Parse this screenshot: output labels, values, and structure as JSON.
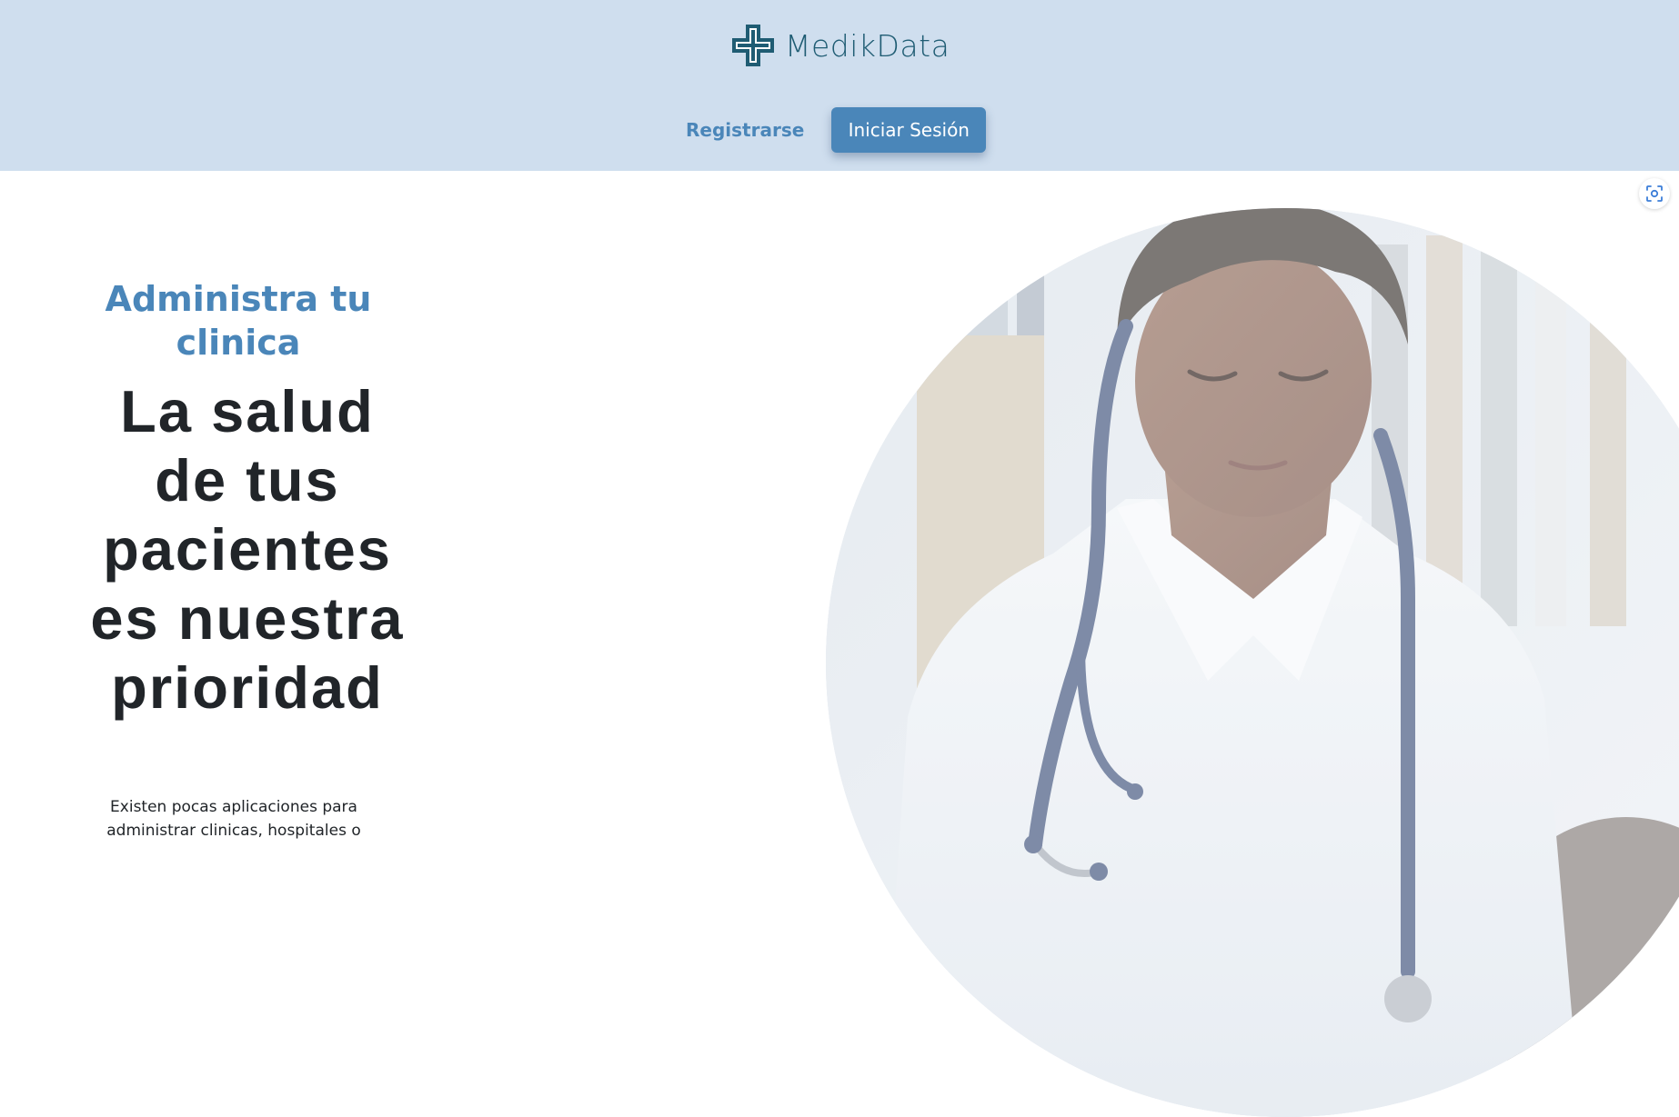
{
  "header": {
    "brand_name": "MedikData",
    "logo_icon": "medical-cross-icon",
    "register_label": "Registrarse",
    "login_label": "Iniciar Sesión",
    "background_color": "#cfdeee",
    "accent_color": "#4a86b9",
    "brand_color": "#1f5c73"
  },
  "hero": {
    "kicker": "Administra tu clinica",
    "title": "La salud de tus pacientes es nuestra prioridad",
    "body": "Existen pocas aplicaciones para administrar clinicas, hospitales o",
    "image_subject": "doctor-with-stethoscope"
  },
  "overlay": {
    "capture_icon": "screen-capture-icon"
  }
}
